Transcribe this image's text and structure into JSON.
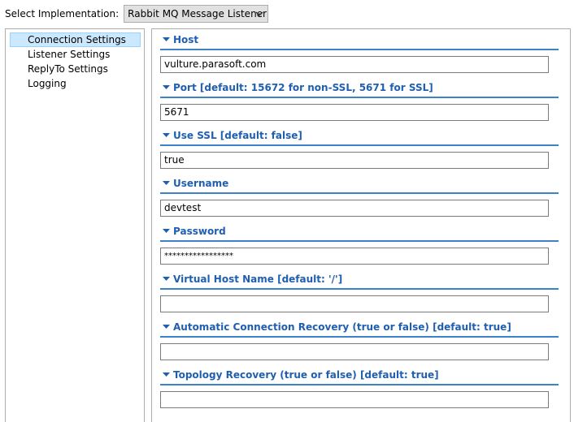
{
  "implementation": {
    "label": "Select Implementation:",
    "selected": "Rabbit MQ Message Listener",
    "dropdown_icon": "chevron-down-icon"
  },
  "nav": {
    "items": [
      {
        "label": "Connection Settings",
        "selected": true
      },
      {
        "label": "Listener Settings",
        "selected": false
      },
      {
        "label": "ReplyTo Settings",
        "selected": false
      },
      {
        "label": "Logging",
        "selected": false
      }
    ]
  },
  "sections": [
    {
      "title": "Host",
      "value": "vulture.parasoft.com"
    },
    {
      "title": "Port [default: 15672 for non-SSL, 5671 for SSL]",
      "value": "5671"
    },
    {
      "title": "Use SSL [default: false]",
      "value": "true"
    },
    {
      "title": "Username",
      "value": "devtest"
    },
    {
      "title": "Password",
      "value": "*****************"
    },
    {
      "title": "Virtual Host Name [default: '/']",
      "value": ""
    },
    {
      "title": "Automatic Connection Recovery (true or false) [default: true]",
      "value": ""
    },
    {
      "title": "Topology Recovery (true or false) [default: true]",
      "value": ""
    }
  ],
  "colors": {
    "section_title": "#1f5fb1",
    "section_rule": "#3c82c8",
    "nav_selected_bg": "#cce8ff"
  },
  "icons": {
    "section_toggle": "expanded-triangle-icon"
  }
}
